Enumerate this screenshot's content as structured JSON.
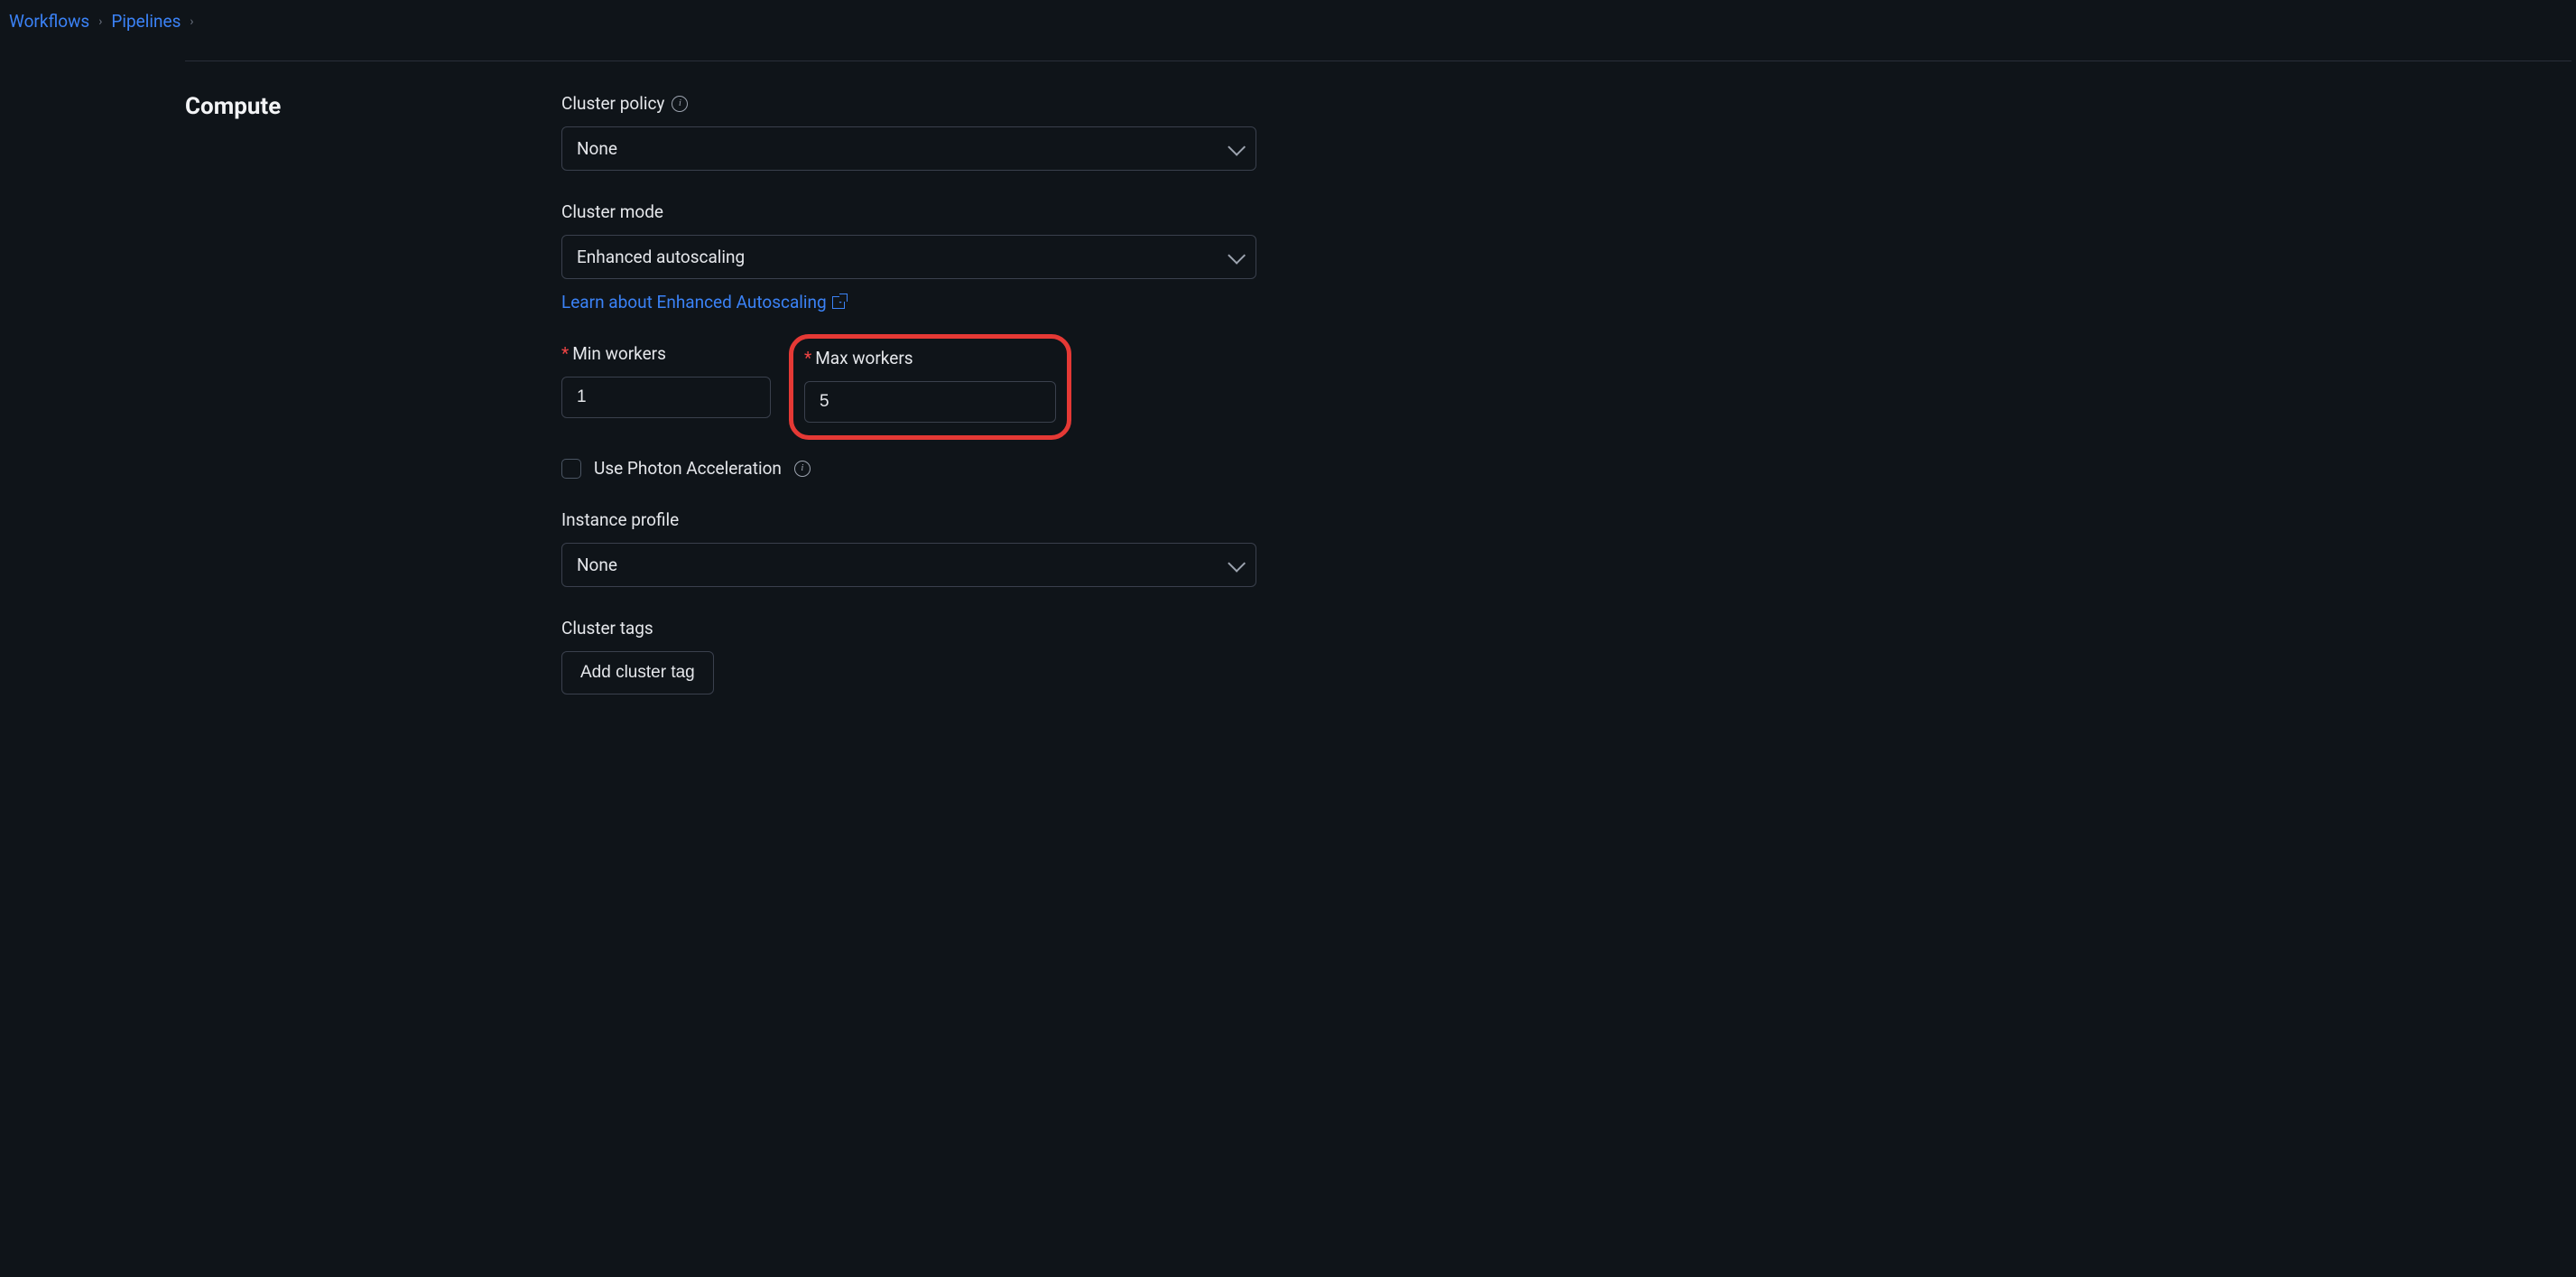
{
  "breadcrumb": {
    "items": [
      "Workflows",
      "Pipelines"
    ]
  },
  "section": {
    "title": "Compute"
  },
  "form": {
    "policy": {
      "label": "Cluster policy",
      "value": "None"
    },
    "mode": {
      "label": "Cluster mode",
      "value": "Enhanced autoscaling",
      "link": "Learn about Enhanced Autoscaling"
    },
    "min": {
      "label": "Min workers",
      "value": "1"
    },
    "max": {
      "label": "Max workers",
      "value": "5"
    },
    "photon": {
      "label": "Use Photon Acceleration",
      "checked": false
    },
    "profile": {
      "label": "Instance profile",
      "value": "None"
    },
    "tags": {
      "label": "Cluster tags",
      "button": "Add cluster tag"
    }
  }
}
